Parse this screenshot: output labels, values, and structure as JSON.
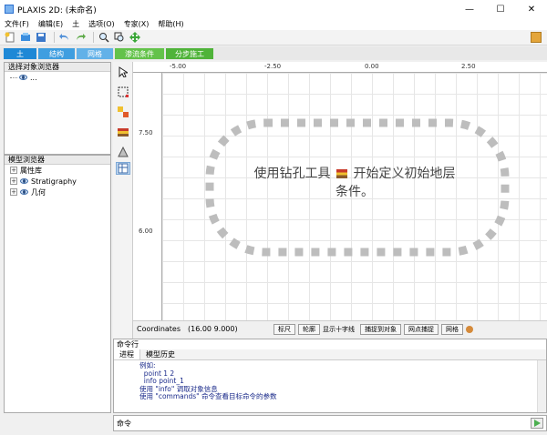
{
  "window": {
    "title": "PLAXIS 2D: (未命名)",
    "minimize": "—",
    "maximize": "☐",
    "close": "✕"
  },
  "menu": [
    "文件(F)",
    "编辑(E)",
    "土",
    "选项(O)",
    "专家(X)",
    "帮助(H)"
  ],
  "modes": [
    "土",
    "结构",
    "网格",
    "渗流条件",
    "分步施工"
  ],
  "selection_explorer": {
    "title": "选择对象浏览器",
    "root": "..."
  },
  "model_explorer": {
    "title": "模型浏览器",
    "items": [
      "属性库",
      "Stratigraphy",
      "几何"
    ]
  },
  "ruler": {
    "top": [
      "-5.00",
      "-2.50",
      "0.00",
      "2.50"
    ],
    "left": [
      "7.50",
      "6.00"
    ]
  },
  "canvas": {
    "hint_line1": "使用钻孔工具",
    "hint_line1b": "开始定义初始地层",
    "hint_line2": "条件。"
  },
  "status": {
    "coordinates_label": "Coordinates",
    "coordinates_value": "(16.00 9.000)",
    "buttons": [
      "标尺",
      "轮廓",
      "显示十字线",
      "捕捉到对象",
      "网点捕捉",
      "网格"
    ]
  },
  "command": {
    "title": "命令行",
    "tabs": [
      "进程",
      "模型历史"
    ],
    "log": [
      "例如:",
      "  point 1 2",
      "  info point_1",
      "使用 \"info\" 调取对象信息",
      "使用 \"commands\" 命令查看目标命令的参数"
    ],
    "input_label": "命令"
  }
}
